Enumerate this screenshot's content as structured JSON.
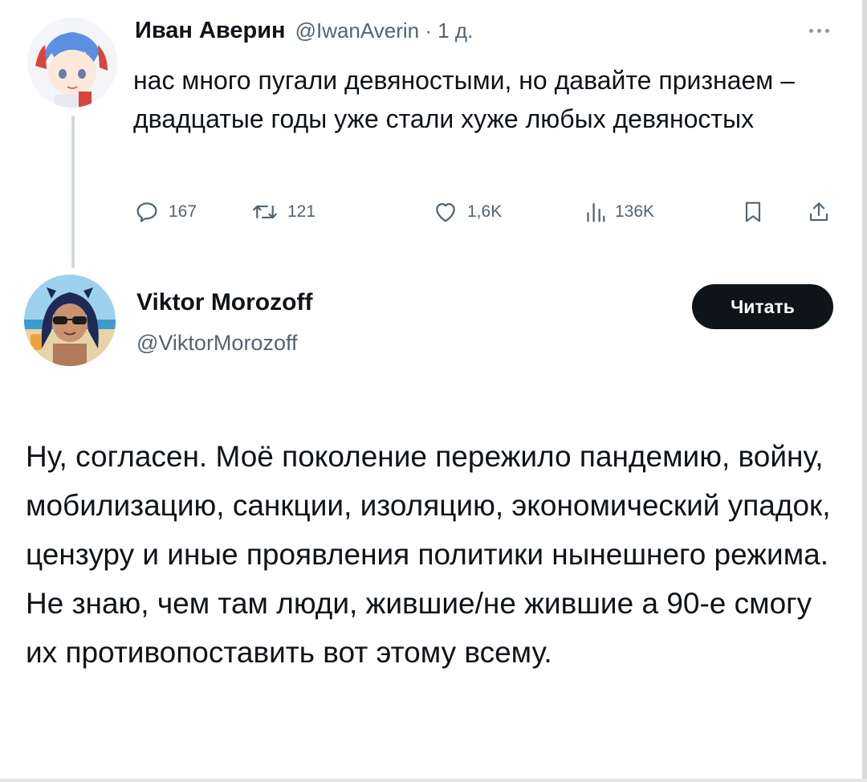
{
  "tweet1": {
    "name": "Иван Аверин",
    "handle": "@IwanAverin",
    "time": "1 д.",
    "text": "нас много пугали девяностыми, но давайте признаем – двадцатые годы уже стали хуже любых девяностых",
    "stats": {
      "replies": "167",
      "retweets": "121",
      "likes": "1,6K",
      "views": "136K"
    }
  },
  "tweet2": {
    "name": "Viktor Morozoff",
    "handle": "@ViktorMorozoff",
    "follow_label": "Читать",
    "text": "Ну, согласен. Моё поколение пережило пандемию, войну, мобилизацию, санкции, изоляцию, экономический упадок, цензуру и иные проявления политики нынешнего режима. Не знаю, чем там люди, жившие/не жившие а 90-е смогу их противопоставить вот этому всему."
  },
  "icons": {
    "more": "more-horizontal-icon",
    "reply": "reply-icon",
    "retweet": "retweet-icon",
    "like": "heart-icon",
    "views": "views-icon",
    "bookmark": "bookmark-icon",
    "share": "share-icon"
  },
  "colors": {
    "text": "#0f1419",
    "secondary": "#536471",
    "thread_line": "#cfd9de",
    "button_bg": "#0f1419"
  }
}
